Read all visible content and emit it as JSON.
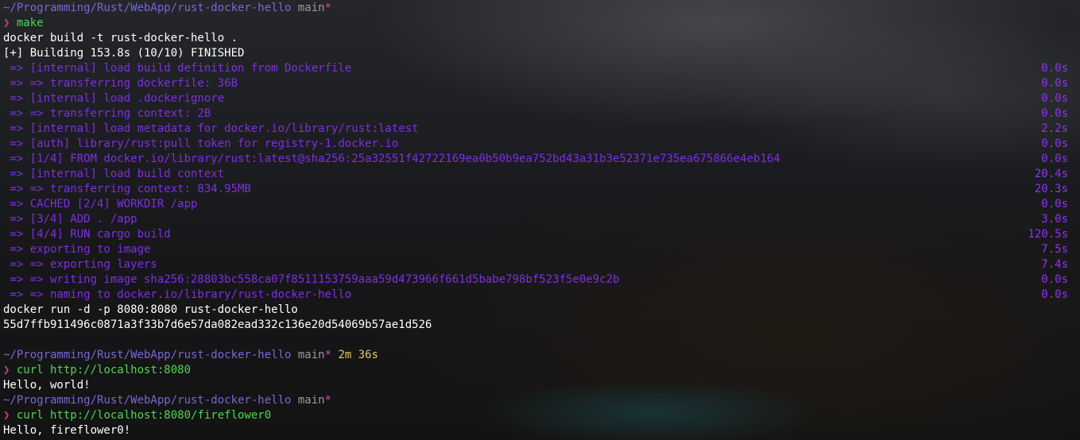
{
  "prompt_symbol": "❯",
  "blocks": {
    "p1": {
      "path": "~/Programming/Rust/WebApp/rust-docker-hello",
      "branch": "main",
      "dirty": "*",
      "duration": ""
    },
    "c1": {
      "command": "make"
    },
    "out1": {
      "cmd_echo": "docker build -t rust-docker-hello .",
      "status": "[+] Building 153.8s (10/10) FINISHED",
      "steps": [
        {
          "text": " => [internal] load build definition from Dockerfile",
          "time": "0.0s"
        },
        {
          "text": " => => transferring dockerfile: 36B",
          "time": "0.0s"
        },
        {
          "text": " => [internal] load .dockerignore",
          "time": "0.0s"
        },
        {
          "text": " => => transferring context: 2B",
          "time": "0.0s"
        },
        {
          "text": " => [internal] load metadata for docker.io/library/rust:latest",
          "time": "2.2s"
        },
        {
          "text": " => [auth] library/rust:pull token for registry-1.docker.io",
          "time": "0.0s"
        },
        {
          "text": " => [1/4] FROM docker.io/library/rust:latest@sha256:25a32551f42722169ea0b50b9ea752bd43a31b3e52371e735ea675866e4eb164",
          "time": "0.0s"
        },
        {
          "text": " => [internal] load build context",
          "time": "20.4s"
        },
        {
          "text": " => => transferring context: 834.95MB",
          "time": "20.3s"
        },
        {
          "text": " => CACHED [2/4] WORKDIR /app",
          "time": "0.0s"
        },
        {
          "text": " => [3/4] ADD . /app",
          "time": "3.0s"
        },
        {
          "text": " => [4/4] RUN cargo build",
          "time": "120.5s"
        },
        {
          "text": " => exporting to image",
          "time": "7.5s"
        },
        {
          "text": " => => exporting layers",
          "time": "7.4s"
        },
        {
          "text": " => => writing image sha256:28803bc558ca07f8511153759aaa59d473966f661d5babe798bf523f5e0e9c2b",
          "time": "0.0s"
        },
        {
          "text": " => => naming to docker.io/library/rust-docker-hello",
          "time": "0.0s"
        }
      ],
      "run_echo": "docker run -d -p 8080:8080 rust-docker-hello",
      "container_id": "55d7ffb911496c0871a3f33b7d6e57da082ead332c136e20d54069b57ae1d526"
    },
    "p2": {
      "path": "~/Programming/Rust/WebApp/rust-docker-hello",
      "branch": "main",
      "dirty": "*",
      "duration": "2m 36s"
    },
    "c2": {
      "command": "curl http://localhost:8080"
    },
    "out2": {
      "text": "Hello, world!"
    },
    "p3": {
      "path": "~/Programming/Rust/WebApp/rust-docker-hello",
      "branch": "main",
      "dirty": "*",
      "duration": ""
    },
    "c3": {
      "command": "curl http://localhost:8080/fireflower0"
    },
    "out3": {
      "text": "Hello, fireflower0!"
    }
  }
}
